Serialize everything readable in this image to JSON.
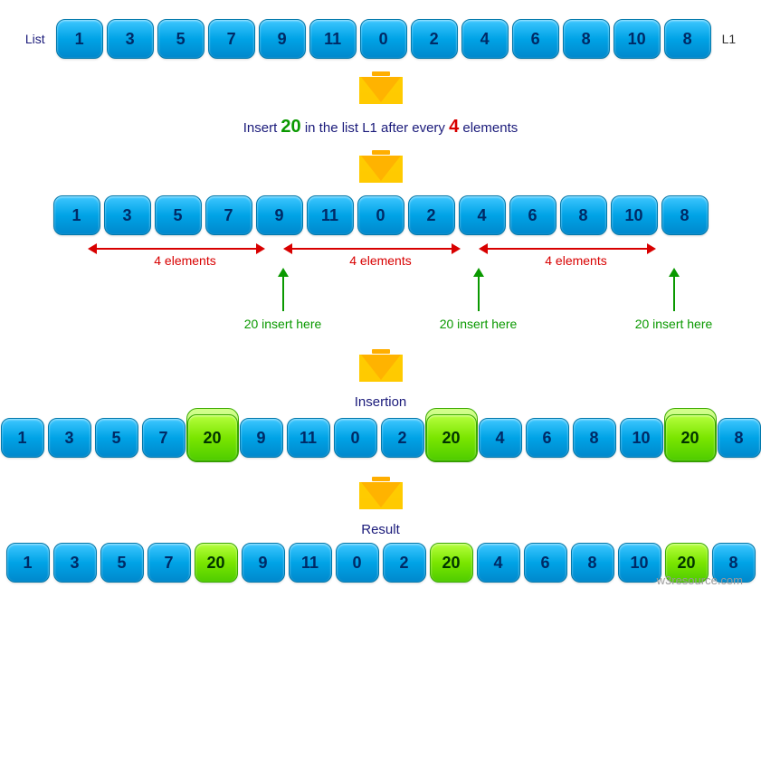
{
  "labels": {
    "list": "List",
    "l1": "L1",
    "insertion": "Insertion",
    "result": "Result",
    "watermark": "w3resource.com"
  },
  "caption": {
    "pre": "Insert ",
    "num20": "20",
    "mid1": " in the list ",
    "l1": "L1",
    "mid2": " after every ",
    "num4": "4",
    "post": " elements"
  },
  "range": {
    "label": "4 elements"
  },
  "insert": {
    "label": "20 insert here"
  },
  "rows": {
    "list1": [
      "1",
      "3",
      "5",
      "7",
      "9",
      "11",
      "0",
      "2",
      "4",
      "6",
      "8",
      "10",
      "8"
    ],
    "list2": [
      "1",
      "3",
      "5",
      "7",
      "9",
      "11",
      "0",
      "2",
      "4",
      "6",
      "8",
      "10",
      "8"
    ],
    "insertion": [
      "1",
      "3",
      "5",
      "7",
      "20",
      "9",
      "11",
      "0",
      "2",
      "20",
      "4",
      "6",
      "8",
      "10",
      "20",
      "8"
    ],
    "result": [
      "1",
      "3",
      "5",
      "7",
      "20",
      "9",
      "11",
      "0",
      "2",
      "20",
      "4",
      "6",
      "8",
      "10",
      "20",
      "8"
    ]
  },
  "green_positions": [
    4,
    9,
    14
  ]
}
